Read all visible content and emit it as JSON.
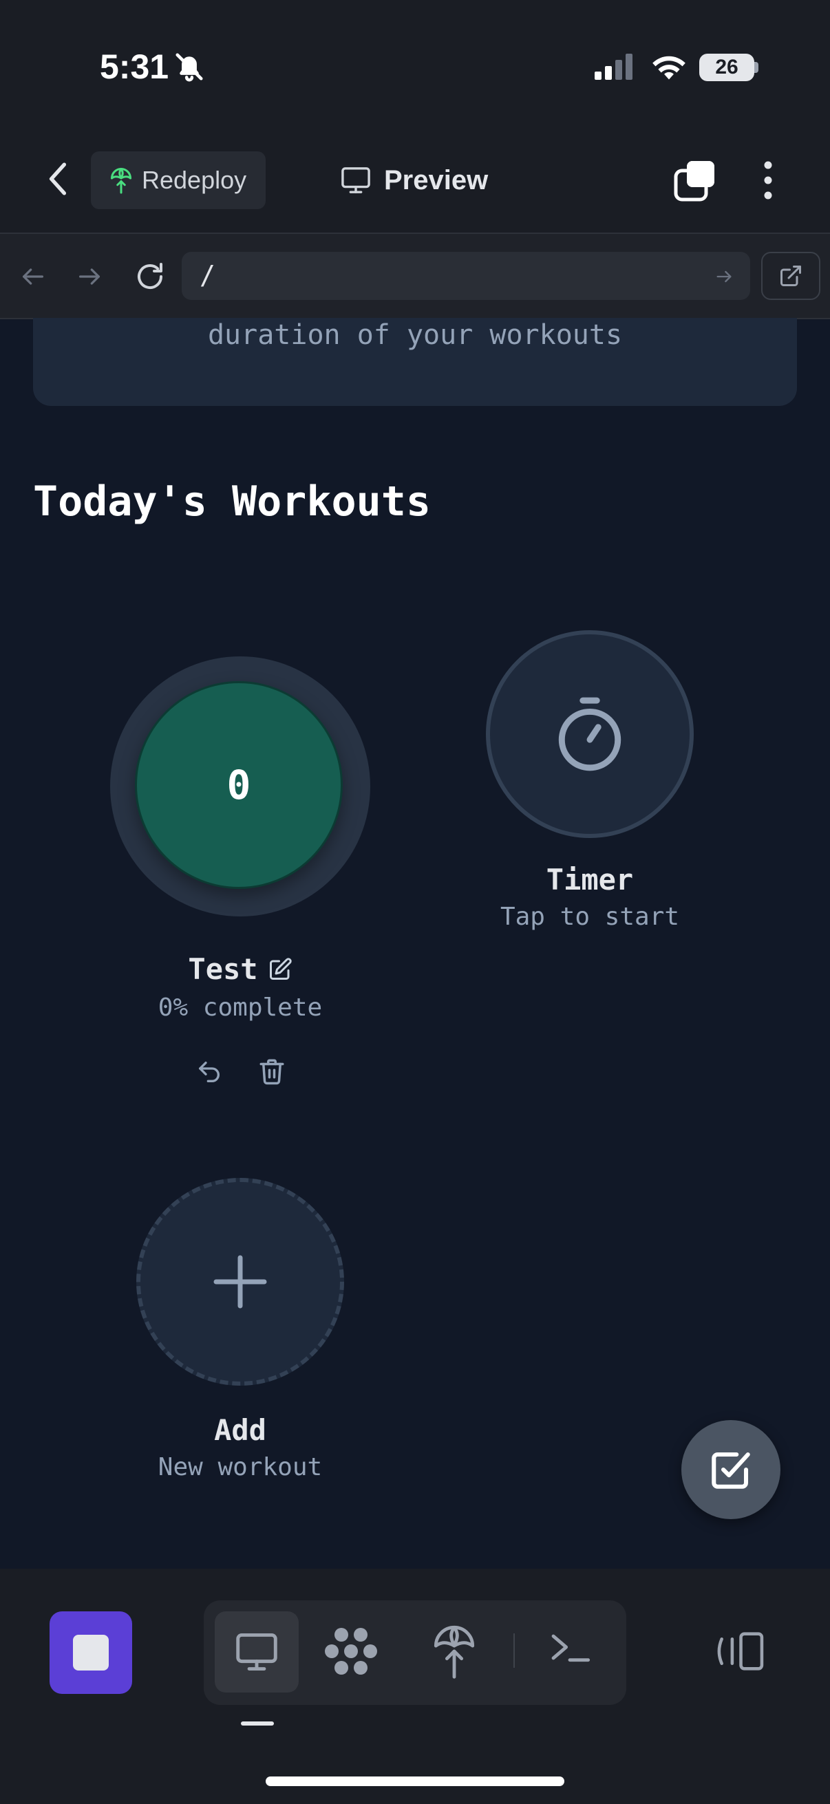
{
  "status_bar": {
    "time": "5:31",
    "battery": "26"
  },
  "header": {
    "redeploy_label": "Redeploy",
    "preview_label": "Preview"
  },
  "browser": {
    "url": "/"
  },
  "info_card": {
    "text": "duration of your workouts"
  },
  "section": {
    "title": "Today's Workouts"
  },
  "workout": {
    "count": "0",
    "name": "Test",
    "progress": "0% complete",
    "progress_fraction": 0
  },
  "timer": {
    "title": "Timer",
    "subtitle": "Tap to start"
  },
  "add": {
    "title": "Add",
    "subtitle": "New workout"
  },
  "colors": {
    "background": "#111827",
    "workout_fill": "#165e51",
    "accent_purple": "#5b3fd6",
    "card": "#1e293b"
  },
  "icons": [
    "bell-slash-icon",
    "signal-icon",
    "wifi-icon",
    "chevron-left-icon",
    "deploy-icon",
    "monitor-icon",
    "tabs-icon",
    "more-vertical-icon",
    "arrow-left-icon",
    "arrow-right-icon",
    "reload-icon",
    "external-link-icon",
    "edit-icon",
    "undo-icon",
    "trash-icon",
    "stopwatch-icon",
    "plus-icon",
    "check-square-icon",
    "stop-icon",
    "desktop-icon",
    "sequence-icon",
    "shell-icon",
    "split-view-icon"
  ]
}
